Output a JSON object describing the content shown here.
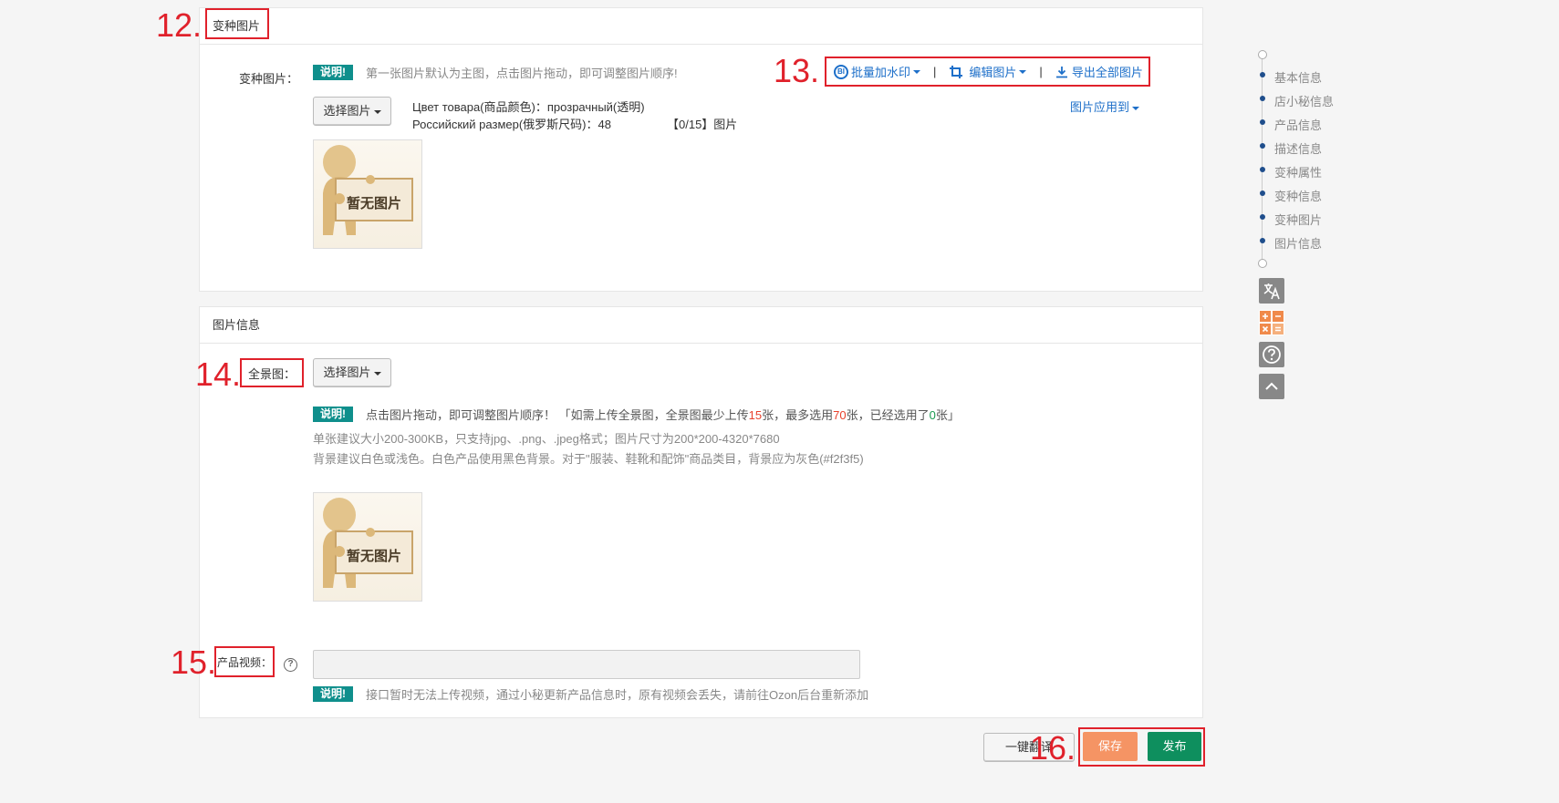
{
  "annotations": {
    "a12": "12.",
    "a13": "13.",
    "a14": "14.",
    "a15": "15.",
    "a16": "16."
  },
  "variant_images": {
    "section_title": "变种图片",
    "field_label": "变种图片：",
    "note_tag": "说明!",
    "note_text": "第一张图片默认为主图，点击图片拖动，即可调整图片顺序!",
    "toolbar": {
      "watermark": "批量加水印",
      "edit": "编辑图片",
      "export": "导出全部图片",
      "separator": "|"
    },
    "select_button": "选择图片",
    "variant_line1": "Цвет товара(商品颜色)：прозрачный(透明)",
    "variant_line2": "Российский размер(俄罗斯尺码)：48",
    "image_count": "【0/15】图片",
    "apply_to": "图片应用到",
    "placeholder_text": "暂无图片"
  },
  "image_info": {
    "section_title": "图片信息",
    "panorama_label": "全景图：",
    "select_button": "选择图片",
    "note_tag": "说明!",
    "note_main_a": "点击图片拖动，即可调整图片顺序！ 「如需上传全景图，全景图最少上传",
    "note_min": "15",
    "note_main_b": "张，最多选用",
    "note_max": "70",
    "note_main_c": "张，已经选用了",
    "note_used": "0",
    "note_main_d": "张」",
    "size_hint": "单张建议大小200-300KB，只支持jpg、.png、.jpeg格式；图片尺寸为200*200-4320*7680",
    "bg_hint": "背景建议白色或浅色。白色产品使用黑色背景。对于\"服装、鞋靴和配饰\"商品类目，背景应为灰色(#f2f3f5)",
    "placeholder_text": "暂无图片",
    "video_label": "产品视频：",
    "video_input_value": "",
    "video_note_tag": "说明!",
    "video_note_text": "接口暂时无法上传视频，通过小秘更新产品信息时，原有视频会丢失，请前往Ozon后台重新添加"
  },
  "footer": {
    "translate_button": "一键翻译",
    "save_button": "保存",
    "publish_button": "发布"
  },
  "side_nav": {
    "items": [
      "基本信息",
      "店小秘信息",
      "产品信息",
      "描述信息",
      "变种属性",
      "变种信息",
      "变种图片",
      "图片信息"
    ]
  },
  "side_tools": {
    "translate_icon": "translate-icon",
    "calculator_icon": "calculator-icon",
    "help_icon": "help-icon",
    "top_icon": "back-to-top-icon"
  },
  "colors": {
    "tag_teal": "#0f8f8c",
    "link_blue": "#1d6fc9",
    "annotation_red": "#e0212b",
    "save_orange": "#f59464",
    "publish_green": "#0e8f5e",
    "num_red": "#e8412c",
    "num_green": "#1a9a50"
  }
}
